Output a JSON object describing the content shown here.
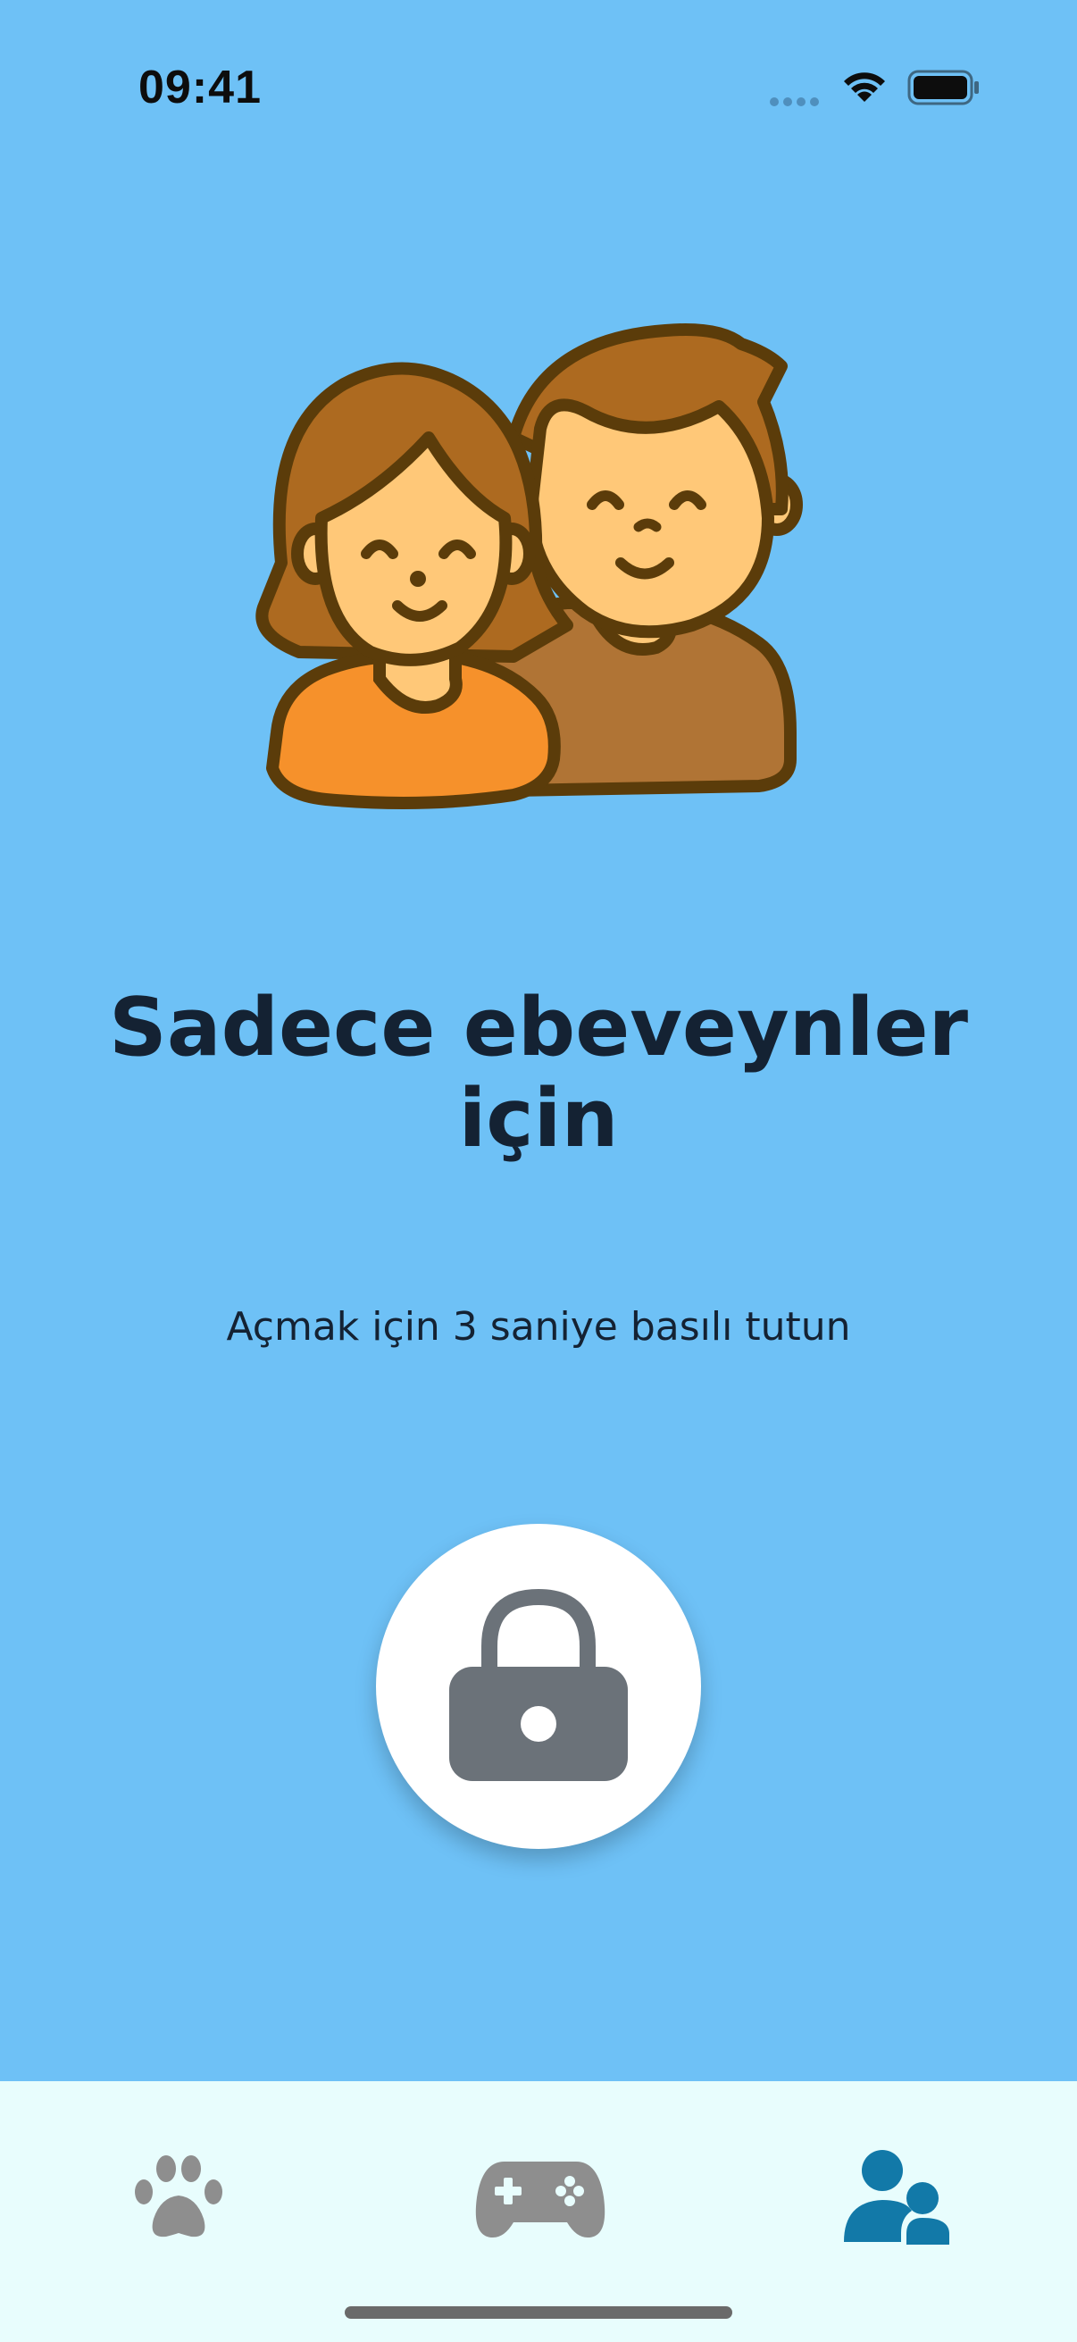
{
  "status_bar": {
    "time": "09:41"
  },
  "content": {
    "title_line1": "Sadece ebeveynler",
    "title_line2": "için",
    "subtitle": "Açmak için 3 saniye basılı tutun",
    "illustration_icon": "parents-illustration",
    "lock_icon": "lock-icon"
  },
  "tab_bar": {
    "tabs": [
      {
        "icon": "paw-icon",
        "active": false
      },
      {
        "icon": "gamepad-icon",
        "active": false
      },
      {
        "icon": "parents-icon",
        "active": true
      }
    ]
  },
  "colors": {
    "background": "#6EC1F6",
    "tab_bar_background": "#E8FDFD",
    "active_tab": "#1279A8",
    "inactive_tab": "#8E8E8E",
    "lock_icon": "#6B7279",
    "title_text": "#142233"
  }
}
